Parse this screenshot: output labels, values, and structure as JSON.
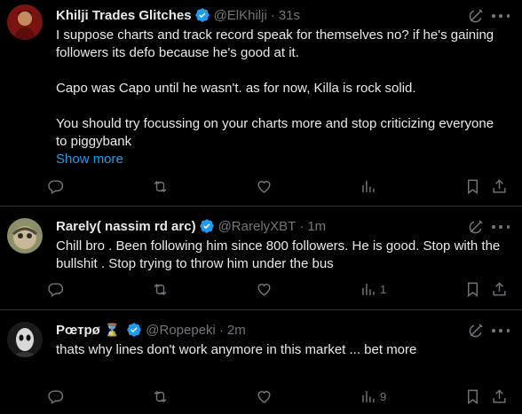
{
  "posts": [
    {
      "name": "Khilji Trades Glitches",
      "handle": "@ElKhilji",
      "time": "31s",
      "text": "I suppose charts and track record speak for themselves no? if he's gaining followers its defo because he's good at it.\n\nCapo was Capo until he wasn't. as for now, Killa is rock solid.\n\nYou should try focussing on your charts more and stop criticizing everyone to piggybank",
      "show_more": "Show more",
      "views": ""
    },
    {
      "name": "Rarely( nassim rd arc)",
      "handle": "@RarelyXBT",
      "time": "1m",
      "text": "Chill bro . Been following him since 800 followers. He is good. Stop with the bullshit . Stop trying to throw him under the bus",
      "views": "1"
    },
    {
      "name": "Рœтрø",
      "name_emoji": "⌛",
      "handle": "@Ropepeki",
      "time": "2m",
      "text": "thats why lines don't work anymore in this market ... bet more",
      "views": "9"
    }
  ],
  "dot": "·",
  "colors": {
    "accent": "#1d9bf0",
    "muted": "#71767b",
    "text": "#e7e9ea",
    "bg": "#000000",
    "divider": "#2f3336"
  },
  "icons": [
    "verified-badge-icon",
    "grok-icon",
    "more-icon",
    "reply-icon",
    "repost-icon",
    "like-icon",
    "views-icon",
    "bookmark-icon",
    "share-icon"
  ]
}
